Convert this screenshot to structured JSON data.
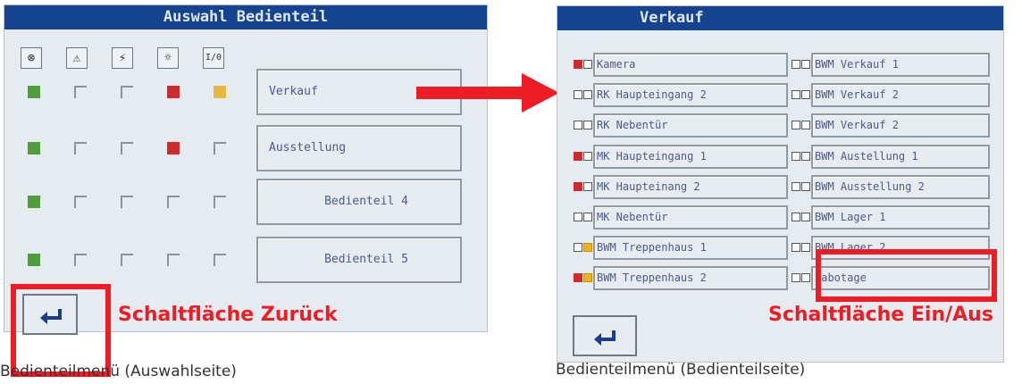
{
  "left": {
    "title": "Auswahl Bedienteil",
    "icons": [
      {
        "icon": "fault-circle-icon",
        "glyph": "⊗"
      },
      {
        "icon": "warning-triangle-icon",
        "glyph": "⚠"
      },
      {
        "icon": "lightning-triangle-icon",
        "glyph": "⚡"
      },
      {
        "icon": "lamp-icon",
        "glyph": "☼"
      },
      {
        "icon": "on-off-icon",
        "glyph": "I/0"
      }
    ],
    "rows": [
      {
        "states": [
          "green",
          "empty",
          "empty",
          "red",
          "yellow"
        ],
        "button": "Verkauf"
      },
      {
        "states": [
          "green",
          "empty",
          "empty",
          "red",
          "empty"
        ],
        "button": "Ausstellung"
      },
      {
        "states": [
          "green",
          "empty",
          "empty",
          "empty",
          "empty"
        ],
        "button": "Bedienteil 4"
      },
      {
        "states": [
          "green",
          "empty",
          "empty",
          "empty",
          "empty"
        ],
        "button": "Bedienteil 5"
      }
    ],
    "callout": "Schaltfläche Zurück",
    "caption": "Bedienteilmenü (Auswahlseite)"
  },
  "right": {
    "title": "Verkauf",
    "left_column": [
      {
        "label": "Kamera",
        "s1": "red",
        "s2": "empty"
      },
      {
        "label": "RK Haupteingang 2",
        "s1": "empty",
        "s2": "empty"
      },
      {
        "label": "RK Nebentür",
        "s1": "empty",
        "s2": "empty"
      },
      {
        "label": "MK Haupteingang 1",
        "s1": "red",
        "s2": "empty"
      },
      {
        "label": "MK Haupteinang 2",
        "s1": "red",
        "s2": "empty"
      },
      {
        "label": "MK Nebentür",
        "s1": "empty",
        "s2": "empty"
      },
      {
        "label": "BWM Treppenhaus 1",
        "s1": "empty",
        "s2": "yellow"
      },
      {
        "label": "BWM Treppenhaus 2",
        "s1": "red",
        "s2": "yellow"
      }
    ],
    "right_column": [
      {
        "label": "BWM Verkauf 1",
        "s1": "empty",
        "s2": "empty"
      },
      {
        "label": "BWM Verkauf 2",
        "s1": "empty",
        "s2": "empty"
      },
      {
        "label": "BWM Verkauf 2",
        "s1": "empty",
        "s2": "empty"
      },
      {
        "label": "BWM Austellung 1",
        "s1": "empty",
        "s2": "empty"
      },
      {
        "label": "BWM Ausstellung 2",
        "s1": "empty",
        "s2": "empty"
      },
      {
        "label": "BWM Lager 1",
        "s1": "empty",
        "s2": "empty"
      },
      {
        "label": "BWM Lager 2",
        "s1": "empty",
        "s2": "empty"
      },
      {
        "label": "Sabotage",
        "s1": "empty",
        "s2": "empty"
      }
    ],
    "callout": "Schaltfläche Ein/Aus",
    "caption": "Bedienteilmenü (Bedienteilseite)"
  },
  "colors": {
    "header": "#16438f",
    "callout": "#ee1c25",
    "green": "#4f9e3c",
    "red": "#d12a2c",
    "yellow": "#e8b83c"
  }
}
